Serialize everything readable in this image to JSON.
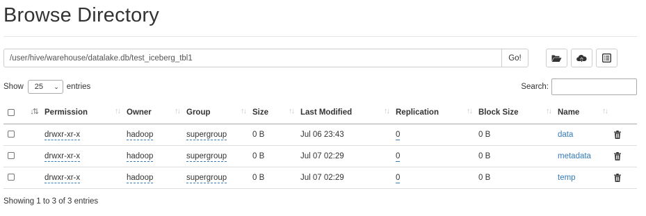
{
  "page": {
    "title": "Browse Directory"
  },
  "path_bar": {
    "path_value": "/user/hive/warehouse/datalake.db/test_iceberg_tbl1",
    "go_label": "Go!"
  },
  "toolbar": {
    "icons": [
      "folder-open-icon",
      "upload-cloud-icon",
      "list-alt-icon"
    ]
  },
  "table_controls": {
    "show_prefix": "Show",
    "page_size": "25",
    "show_suffix": "entries",
    "search_label": "Search:"
  },
  "table": {
    "columns": [
      "Permission",
      "Owner",
      "Group",
      "Size",
      "Last Modified",
      "Replication",
      "Block Size",
      "Name"
    ],
    "rows": [
      {
        "permission": "drwxr-xr-x",
        "owner": "hadoop",
        "group": "supergroup",
        "size": "0 B",
        "modified": "Jul 06 23:43",
        "replication": "0",
        "block_size": "0 B",
        "name": "data"
      },
      {
        "permission": "drwxr-xr-x",
        "owner": "hadoop",
        "group": "supergroup",
        "size": "0 B",
        "modified": "Jul 07 02:29",
        "replication": "0",
        "block_size": "0 B",
        "name": "metadata"
      },
      {
        "permission": "drwxr-xr-x",
        "owner": "hadoop",
        "group": "supergroup",
        "size": "0 B",
        "modified": "Jul 07 02:29",
        "replication": "0",
        "block_size": "0 B",
        "name": "temp"
      }
    ]
  },
  "footer": {
    "info": "Showing 1 to 3 of 3 entries"
  },
  "colors": {
    "link": "#337ab7",
    "border": "#cccccc",
    "text": "#333333"
  }
}
